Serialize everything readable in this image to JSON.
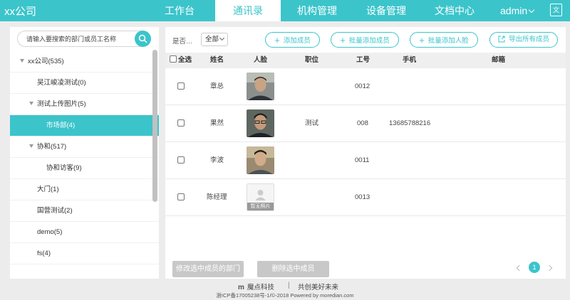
{
  "header": {
    "brand": "xx公司",
    "nav": [
      {
        "label": "工作台",
        "active": false
      },
      {
        "label": "通讯录",
        "active": true
      },
      {
        "label": "机构管理",
        "active": false
      },
      {
        "label": "设备管理",
        "active": false
      },
      {
        "label": "文档中心",
        "active": false
      }
    ],
    "user": "admin",
    "icons": {
      "user_menu": "chevron-down-icon",
      "language": "translate-icon"
    }
  },
  "sidebar": {
    "search_placeholder": "请输入要搜索的部门或员工名称",
    "tree": [
      {
        "label": "xx公司(535)",
        "level": 0,
        "expanded": true
      },
      {
        "label": "吴江峻凌测试(0)",
        "level": 1
      },
      {
        "label": "测试上传图片(5)",
        "level": 1,
        "expanded": true
      },
      {
        "label": "市场部(4)",
        "level": 2,
        "selected": true
      },
      {
        "label": "协和(517)",
        "level": 1,
        "expanded": true
      },
      {
        "label": "协和访客(9)",
        "level": 2
      },
      {
        "label": "大门(1)",
        "level": 1
      },
      {
        "label": "国营测试(2)",
        "level": 1
      },
      {
        "label": "demo(5)",
        "level": 1
      },
      {
        "label": "fs(4)",
        "level": 1
      }
    ]
  },
  "toolbar": {
    "filter_label": "是否…",
    "filter_value": "全部",
    "add_member": "添加成员",
    "batch_add_member": "批量添加成员",
    "batch_add_face": "批量添加人脸",
    "export_all": "导出所有成员"
  },
  "table": {
    "columns": {
      "select_all": "全选",
      "name": "姓名",
      "face": "人脸",
      "position": "职位",
      "employee_id": "工号",
      "phone": "手机",
      "email": "邮箱"
    },
    "rows": [
      {
        "name": "章总",
        "position": "",
        "employee_id": "0012",
        "phone": "",
        "email": "",
        "has_photo": true
      },
      {
        "name": "果然",
        "position": "测试",
        "employee_id": "008",
        "phone": "13685788216",
        "email": "",
        "has_photo": true
      },
      {
        "name": "李波",
        "position": "",
        "employee_id": "0011",
        "phone": "",
        "email": "",
        "has_photo": true
      },
      {
        "name": "陈经理",
        "position": "",
        "employee_id": "0013",
        "phone": "",
        "email": "",
        "has_photo": false,
        "no_photo_label": "暂无照片"
      }
    ]
  },
  "actions": {
    "change_department": "修改选中成员的部门",
    "delete_selected": "删除选中成员"
  },
  "pagination": {
    "current_page": "1"
  },
  "footer": {
    "logo_mark": "m",
    "company": "魔点科技",
    "separator": "|",
    "slogan": "共创美好未来",
    "copyright": "浙ICP备17005238号-1/©-2018 Powered by moredian.com"
  },
  "colors": {
    "accent": "#3cc4cb",
    "disabled_button": "#c8c8c8"
  }
}
